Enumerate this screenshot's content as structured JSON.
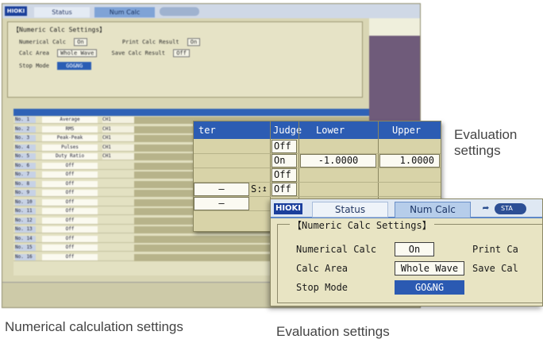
{
  "captions": {
    "bottom_left": "Numerical calculation settings",
    "bottom_right": "Evaluation settings",
    "right_line1": "Evaluation",
    "right_line2": "settings"
  },
  "eval_table": {
    "col_headers": [
      "ter",
      "Judge",
      "Lower",
      "Upper"
    ],
    "rows": [
      {
        "judge": "Off",
        "lower": "",
        "upper": ""
      },
      {
        "judge": "On",
        "lower": "-1.0000",
        "upper": "1.0000"
      },
      {
        "judge": "Off",
        "lower": "",
        "upper": ""
      },
      {
        "param": "–",
        "marker": "S:",
        "judge": "Off",
        "lower": "",
        "upper": ""
      },
      {
        "param": "–",
        "judge": "",
        "lower": "",
        "upper": ""
      }
    ],
    "header_color": "#2c5cb3"
  },
  "numcalc": {
    "logo": "HIOKI",
    "tabs": [
      "Status",
      "Num Calc"
    ],
    "start_icon_text": "STA",
    "section_title": "【Numeric Calc Settings】",
    "numerical_calc_label": "Numerical Calc",
    "numerical_calc_value": "On",
    "calc_area_label": "Calc Area",
    "calc_area_value": "Whole Wave",
    "stop_mode_label": "Stop Mode",
    "stop_mode_value": "GO&NG",
    "print_calc_label": "Print Ca",
    "save_calc_label": "Save Cal",
    "selected_color": "#2b5ab2"
  },
  "bg_screen": {
    "logo": "HIOKI",
    "tabs": [
      "Status",
      "Num Calc"
    ],
    "section_title": "【Numeric Calc Settings】",
    "rows": [
      {
        "label": "Numerical Calc",
        "value": "On",
        "label2": "Print Calc Result",
        "value2": "On"
      },
      {
        "label": "Calc Area",
        "value": "Whole Wave",
        "label2": "Save Calc Result",
        "value2": "Off"
      },
      {
        "label": "Stop Mode",
        "value": "GO&NG"
      }
    ],
    "table_rows": [
      {
        "no": "No. 1",
        "type": "Average",
        "ch": "CH1"
      },
      {
        "no": "No. 2",
        "type": "RMS",
        "ch": "CH1"
      },
      {
        "no": "No. 3",
        "type": "Peak-Peak",
        "ch": "CH1"
      },
      {
        "no": "No. 4",
        "type": "Pulses",
        "ch": "CH1"
      },
      {
        "no": "No. 5",
        "type": "Duty Ratio",
        "ch": "CH1"
      },
      {
        "no": "No. 6",
        "type": "Off"
      },
      {
        "no": "No. 7",
        "type": "Off"
      },
      {
        "no": "No. 8",
        "type": "Off"
      },
      {
        "no": "No. 9",
        "type": "Off"
      },
      {
        "no": "No. 10",
        "type": "Off"
      },
      {
        "no": "No. 11",
        "type": "Off"
      },
      {
        "no": "No. 12",
        "type": "Off"
      },
      {
        "no": "No. 13",
        "type": "Off"
      },
      {
        "no": "No. 14",
        "type": "Off"
      },
      {
        "no": "No. 15",
        "type": "Off"
      },
      {
        "no": "No. 16",
        "type": "Off"
      }
    ]
  }
}
